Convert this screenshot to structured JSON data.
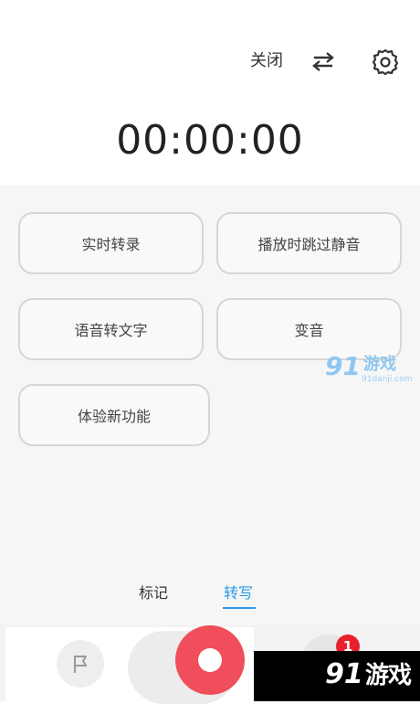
{
  "header": {
    "close_label": "关闭",
    "swap_icon": "swap-arrows-icon",
    "settings_icon": "gear-icon"
  },
  "timer": {
    "value": "00:00:00"
  },
  "options": [
    {
      "label": "实时转录"
    },
    {
      "label": "播放时跳过静音"
    },
    {
      "label": "语音转文字"
    },
    {
      "label": "变音"
    },
    {
      "label": "体验新功能"
    }
  ],
  "tabs": {
    "mark": "标记",
    "transcribe": "转写",
    "active": "转写"
  },
  "bottom": {
    "flag_icon": "flag-icon",
    "record_icon": "record-icon",
    "badge_count": "1"
  },
  "watermark": {
    "logo_number": "91",
    "logo_text": "游戏",
    "domain": "91danji.com"
  },
  "colors": {
    "accent": "#2b9ae8",
    "record": "#f04e5a",
    "badge": "#e8202e"
  }
}
